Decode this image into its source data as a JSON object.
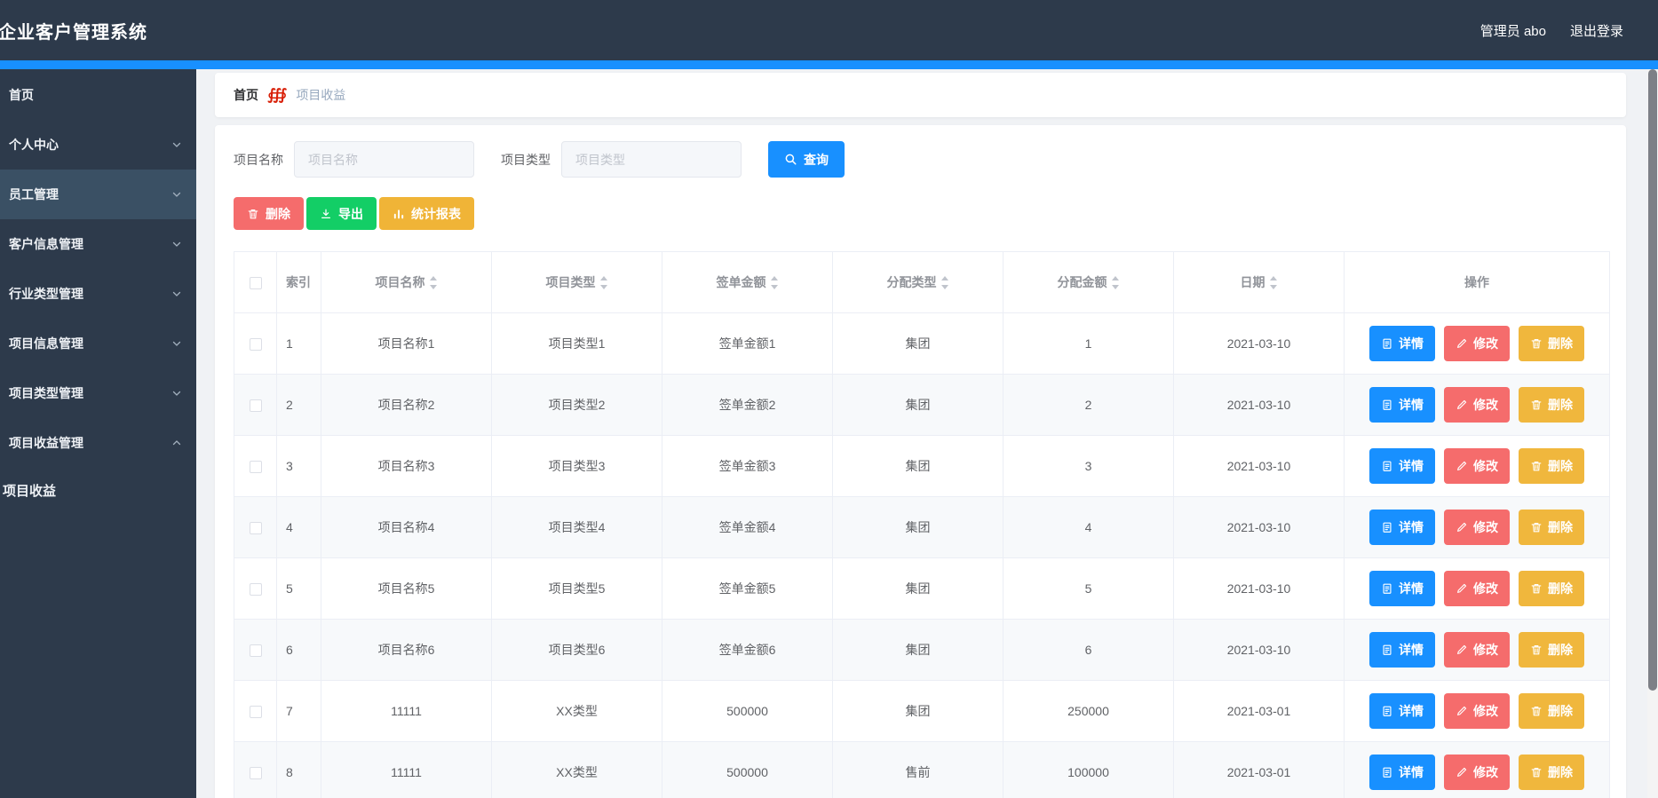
{
  "header": {
    "title": "企业客户管理系统",
    "username": "管理员 abo",
    "logout": "退出登录"
  },
  "sidebar": {
    "items": [
      {
        "label": "首页",
        "chevron": null,
        "active": false,
        "submenu": false
      },
      {
        "label": "个人中心",
        "chevron": "down",
        "active": false,
        "submenu": false
      },
      {
        "label": "员工管理",
        "chevron": "down",
        "active": true,
        "submenu": false
      },
      {
        "label": "客户信息管理",
        "chevron": "down",
        "active": false,
        "submenu": false
      },
      {
        "label": "行业类型管理",
        "chevron": "down",
        "active": false,
        "submenu": false
      },
      {
        "label": "项目信息管理",
        "chevron": "down",
        "active": false,
        "submenu": false
      },
      {
        "label": "项目类型管理",
        "chevron": "down",
        "active": false,
        "submenu": false
      },
      {
        "label": "项目收益管理",
        "chevron": "up",
        "active": false,
        "submenu": false
      },
      {
        "label": "项目收益",
        "chevron": null,
        "active": false,
        "submenu": true
      }
    ]
  },
  "breadcrumb": {
    "home": "首页",
    "separator": "∰",
    "current": "项目收益"
  },
  "filters": {
    "name_label": "项目名称",
    "name_placeholder": "项目名称",
    "name_value": "",
    "type_label": "项目类型",
    "type_placeholder": "项目类型",
    "type_value": "",
    "search_label": "查询"
  },
  "toolbar": {
    "delete_label": "删除",
    "export_label": "导出",
    "report_label": "统计报表"
  },
  "table": {
    "columns": [
      {
        "label": "索引",
        "sortable": false
      },
      {
        "label": "项目名称",
        "sortable": true
      },
      {
        "label": "项目类型",
        "sortable": true
      },
      {
        "label": "签单金额",
        "sortable": true
      },
      {
        "label": "分配类型",
        "sortable": true
      },
      {
        "label": "分配金额",
        "sortable": true
      },
      {
        "label": "日期",
        "sortable": true
      },
      {
        "label": "操作",
        "sortable": false
      }
    ],
    "rows": [
      {
        "index": "1",
        "name": "项目名称1",
        "type": "项目类型1",
        "sign_amount": "签单金额1",
        "alloc_type": "集团",
        "alloc_amount": "1",
        "date": "2021-03-10"
      },
      {
        "index": "2",
        "name": "项目名称2",
        "type": "项目类型2",
        "sign_amount": "签单金额2",
        "alloc_type": "集团",
        "alloc_amount": "2",
        "date": "2021-03-10"
      },
      {
        "index": "3",
        "name": "项目名称3",
        "type": "项目类型3",
        "sign_amount": "签单金额3",
        "alloc_type": "集团",
        "alloc_amount": "3",
        "date": "2021-03-10"
      },
      {
        "index": "4",
        "name": "项目名称4",
        "type": "项目类型4",
        "sign_amount": "签单金额4",
        "alloc_type": "集团",
        "alloc_amount": "4",
        "date": "2021-03-10"
      },
      {
        "index": "5",
        "name": "项目名称5",
        "type": "项目类型5",
        "sign_amount": "签单金额5",
        "alloc_type": "集团",
        "alloc_amount": "5",
        "date": "2021-03-10"
      },
      {
        "index": "6",
        "name": "项目名称6",
        "type": "项目类型6",
        "sign_amount": "签单金额6",
        "alloc_type": "集团",
        "alloc_amount": "6",
        "date": "2021-03-10"
      },
      {
        "index": "7",
        "name": "11111",
        "type": "XX类型",
        "sign_amount": "500000",
        "alloc_type": "集团",
        "alloc_amount": "250000",
        "date": "2021-03-01"
      },
      {
        "index": "8",
        "name": "11111",
        "type": "XX类型",
        "sign_amount": "500000",
        "alloc_type": "售前",
        "alloc_amount": "100000",
        "date": "2021-03-01"
      }
    ],
    "actions": {
      "detail": "详情",
      "edit": "修改",
      "delete": "删除"
    }
  },
  "colors": {
    "header_bg": "#2d3a4b",
    "accent": "#1890ff",
    "danger": "#f56c6c",
    "success": "#13ce66",
    "warning": "#f0b437",
    "stripe": "#f7f9fb"
  }
}
